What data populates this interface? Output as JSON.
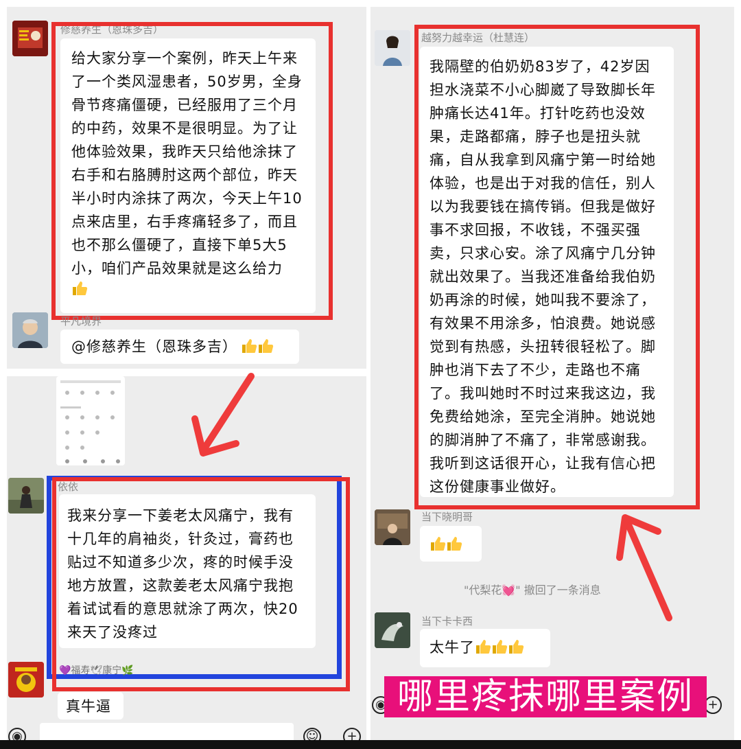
{
  "left_top": {
    "sender_name": "修慈养生（恩珠多吉）",
    "case_message": "给大家分享一个案例，昨天上午来了一个类风湿患者，50岁男，全身骨节疼痛僵硬，已经服用了三个月的中药，效果不是很明显。为了让他体验效果，我昨天只给他涂抹了右手和右胳膊肘这两个部位，昨天半小时内涂抹了两次，今天上午10点来店里，右手疼痛轻多了，而且也不那么僵硬了，直接下单5大5小，咱们产品效果就是这么给力",
    "reply_sender": "平凡境界",
    "reply_message": "@修慈养生（恩珠多吉）"
  },
  "left_bottom": {
    "sender_name": "依依",
    "message": "我来分享一下姜老太风痛宁，我有十几年的肩袖炎，针灸过，膏药也贴过不知道多少次，疼的时候手没地方放置，这款姜老太风痛宁我抱着试试看的意思就涂了两次，快20来天了没疼过",
    "next_sender": "💜福寿🕊康宁🌿",
    "next_message": "真牛逼"
  },
  "right": {
    "sender_name": "越努力越幸运（杜慧连）",
    "message": "我隔壁的伯奶奶83岁了，42岁因担水浇菜不小心脚崴了导致脚长年肿痛长达41年。打针吃药也没效果，走路都痛，脖子也是扭头就痛，自从我拿到风痛宁第一时给她体验，也是出于对我的信任，别人以为我要钱在搞传销。但我是做好事不求回报，不收钱，不强买强卖，只求心安。涂了风痛宁几分钟就出效果了。当我还准备给我伯奶奶再涂的时候，她叫我不要涂了，有效果不用涂多，怕浪费。她说感觉到有热感，头扭转很轻松了。脚肿也消下去了不少，走路也不痛了。我叫她时不时过来我这边，我免费给她涂，至完全消肿。她说她的脚消肿了不痛了，非常感谢我。我听到这话很开心，让我有信心把这份健康事业做好。",
    "reply1_sender": "当下晓明哥",
    "recall_notice": "\"代梨花💓\" 撤回了一条消息",
    "reply2_sender": "当下卡卡西",
    "reply2_message": "太牛了"
  },
  "banner": {
    "text": "哪里疼抹哪里案例",
    "background": "#e8107a",
    "color": "#ffffff"
  },
  "colors": {
    "highlight_red": "#e8312f",
    "highlight_blue": "#2244dd",
    "chat_bg": "#ededed"
  },
  "icons": [
    "thumbs-up-icon",
    "red-arrow-icon",
    "plus-icon",
    "voice-icon"
  ]
}
